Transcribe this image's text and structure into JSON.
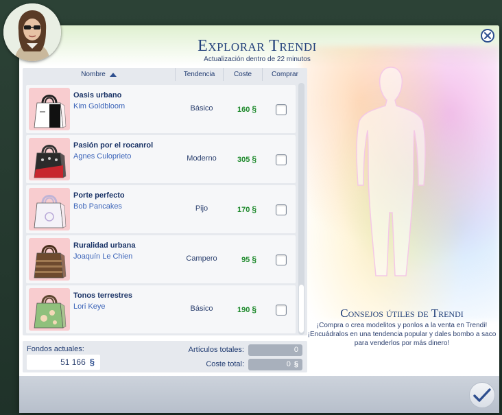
{
  "dialog": {
    "title": "Explorar Trendi",
    "subtitle": "Actualización dentro de 22 minutos"
  },
  "table": {
    "columns": {
      "name": "Nombre",
      "trend": "Tendencia",
      "cost": "Coste",
      "buy": "Comprar"
    },
    "currency_symbol": "§",
    "rows": [
      {
        "name": "Oasis urbano",
        "author": "Kim Goldbloom",
        "trend": "Básico",
        "cost": "160",
        "checked": false,
        "bag_color": "#ffffff",
        "bag_pattern": "white-black"
      },
      {
        "name": "Pasión por el rocanrol",
        "author": "Agnes Culoprieto",
        "trend": "Moderno",
        "cost": "305",
        "checked": false,
        "bag_color": "#2b2b2b",
        "bag_pattern": "black-red"
      },
      {
        "name": "Porte perfecto",
        "author": "Bob Pancakes",
        "trend": "Pijo",
        "cost": "170",
        "checked": false,
        "bag_color": "#f4f2f8",
        "bag_pattern": "white-lilac"
      },
      {
        "name": "Ruralidad urbana",
        "author": "Joaquín Le Chien",
        "trend": "Campero",
        "cost": "95",
        "checked": false,
        "bag_color": "#6e4a2e",
        "bag_pattern": "brown-stripes"
      },
      {
        "name": "Tonos terrestres",
        "author": "Lori Keye",
        "trend": "Básico",
        "cost": "190",
        "checked": false,
        "bag_color": "#8fc07c",
        "bag_pattern": "green-flowers"
      }
    ]
  },
  "footer": {
    "funds_label": "Fondos actuales:",
    "funds_value": "51 166",
    "total_items_label": "Artículos totales:",
    "total_items_value": "0",
    "total_cost_label": "Coste total:",
    "total_cost_value": "0"
  },
  "tips": {
    "title": "Consejos útiles de Trendi",
    "text": "¡Compra o crea modelitos y ponlos a la venta en Trendi! ¡Encuádralos en una tendencia popular y dales bombo a saco para venderlos por más dinero!"
  },
  "colors": {
    "accent_blue": "#22407a",
    "cost_green": "#1e8a2c",
    "thumb_bg": "#f8cccf"
  }
}
